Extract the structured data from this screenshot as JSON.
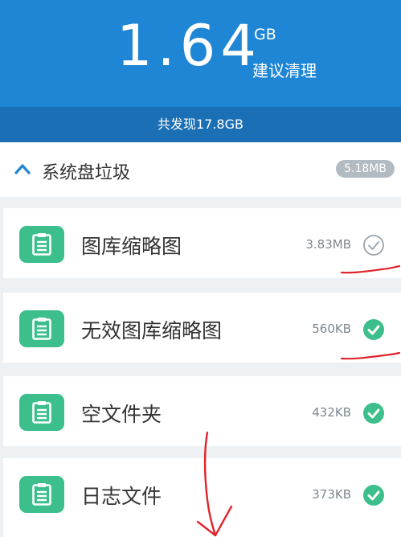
{
  "header": {
    "total_value": "1.64",
    "unit": "GB",
    "advice": "建议清理"
  },
  "found_bar": {
    "text": "共发现17.8GB"
  },
  "section": {
    "title": "系统盘垃圾",
    "size": "5.18MB",
    "expanded": true
  },
  "items": [
    {
      "name": "图库缩略图",
      "size": "3.83MB",
      "checked": false
    },
    {
      "name": "无效图库缩略图",
      "size": "560KB",
      "checked": true
    },
    {
      "name": "空文件夹",
      "size": "432KB",
      "checked": true
    },
    {
      "name": "日志文件",
      "size": "373KB",
      "checked": true
    }
  ],
  "colors": {
    "header": "#1f86d5",
    "found_bar": "#1b6fb4",
    "accent_green": "#3cbf8c",
    "annotation_red": "#e0242c"
  }
}
